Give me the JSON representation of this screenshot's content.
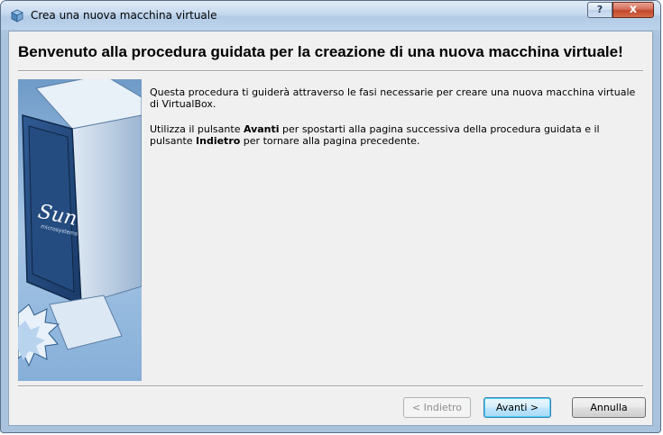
{
  "window": {
    "title": "Crea una nuova macchina virtuale",
    "help_label": "?",
    "close_label": "x"
  },
  "wizard": {
    "heading": "Benvenuto alla procedura guidata per la creazione di una nuova macchina virtuale!",
    "intro": "Questa procedura ti guiderà attraverso le fasi necessarie per creare una nuova macchina virtuale di VirtualBox.",
    "nav_text_prefix": "Utilizza il pulsante ",
    "nav_text_next_word": "Avanti",
    "nav_text_middle": " per spostarti alla pagina successiva della procedura guidata e il pulsante ",
    "nav_text_back_word": "Indietro",
    "nav_text_suffix": " per tornare alla pagina precedente.",
    "logo_text": "Sun",
    "logo_subtext": "microsystems"
  },
  "buttons": {
    "back": "< Indietro",
    "next": "Avanti >",
    "cancel": "Annulla"
  },
  "colors": {
    "heading_sep": "#a0a0a0",
    "default_button_border": "#3c7fb1",
    "close_button": "#c2462c"
  }
}
